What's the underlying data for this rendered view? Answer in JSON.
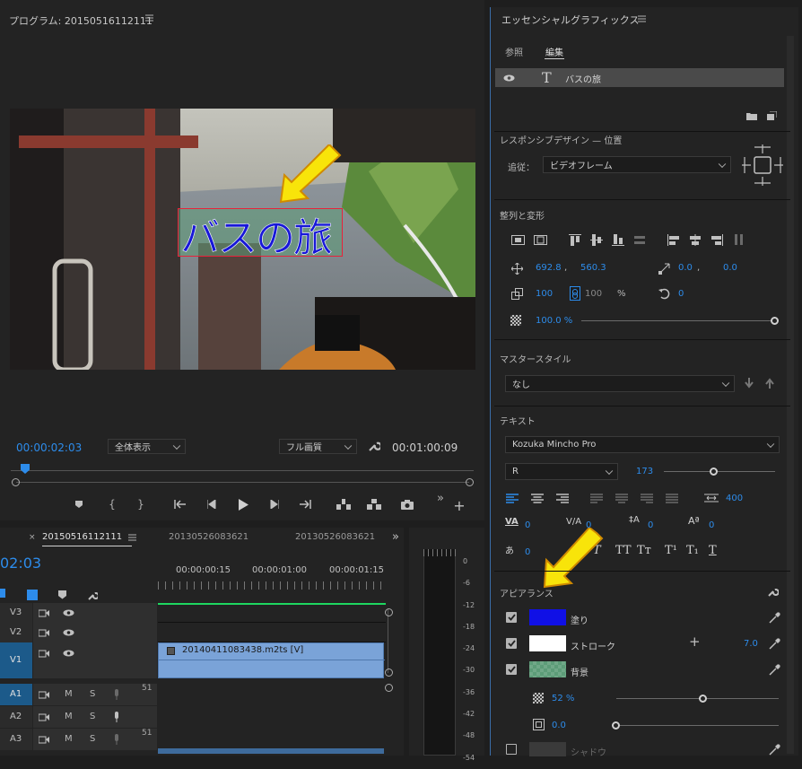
{
  "program": {
    "title": "プログラム: 20150516112111",
    "overlay_text": "バスの旅",
    "timecode": "00:00:02:03",
    "fit": "全体表示",
    "quality": "フル画質",
    "duration": "00:01:00:09"
  },
  "timeline": {
    "tab_active": "20150516112111",
    "tabs": [
      "20130526083621",
      "20130526083621"
    ],
    "timecode": "02:03",
    "ruler": [
      "00:00:00:15",
      "00:00:01:00",
      "00:00:01:15"
    ],
    "video_tracks": [
      {
        "name": "V3"
      },
      {
        "name": "V2"
      },
      {
        "name": "V1"
      }
    ],
    "audio_tracks": [
      {
        "name": "A1",
        "m": "M",
        "s": "S",
        "meter": "51"
      },
      {
        "name": "A2",
        "m": "M",
        "s": "S",
        "meter": ""
      },
      {
        "name": "A3",
        "m": "M",
        "s": "S",
        "meter": "51"
      }
    ],
    "clip_label": "20140411083438.m2ts [V]"
  },
  "meter_scale": [
    "0",
    "-6",
    "-12",
    "-18",
    "-24",
    "-30",
    "-36",
    "-42",
    "-48",
    "-54"
  ],
  "eg": {
    "title": "エッセンシャルグラフィックス",
    "tabs": [
      "参照",
      "編集"
    ],
    "layer_name": "バスの旅",
    "responsive": {
      "label": "レスポンシブデザイン — 位置",
      "follow_label": "追従：",
      "follow_value": "ビデオフレーム"
    },
    "align": {
      "label": "整列と変形",
      "pos_x": "692.8",
      "pos_y": "560.3",
      "anchor_x": "0.0",
      "anchor_y": "0.0",
      "scale": "100",
      "scale2": "100",
      "pct": "%",
      "rotation": "0",
      "opacity": "100.0 %"
    },
    "master": {
      "label": "マスタースタイル",
      "value": "なし"
    },
    "text": {
      "label": "テキスト",
      "font": "Kozuka Mincho Pro",
      "style": "R",
      "size": "173",
      "tracking_value": "400",
      "kerning": "0",
      "tracking": "0",
      "leading": "0",
      "baseline": "0",
      "tsume": "0"
    },
    "appearance": {
      "label": "アピアランス",
      "fill_label": "塗り",
      "stroke_label": "ストローク",
      "stroke_width": "7.0",
      "bg_label": "背景",
      "bg_opacity": "52 %",
      "bg_size": "0.0",
      "shadow_label": "シャドウ"
    },
    "colors": {
      "fill": "#1010e6",
      "stroke": "#ffffff",
      "bg": "#5c9c78",
      "accent": "#2d8ceb",
      "arrow": "#f8e40a"
    }
  }
}
